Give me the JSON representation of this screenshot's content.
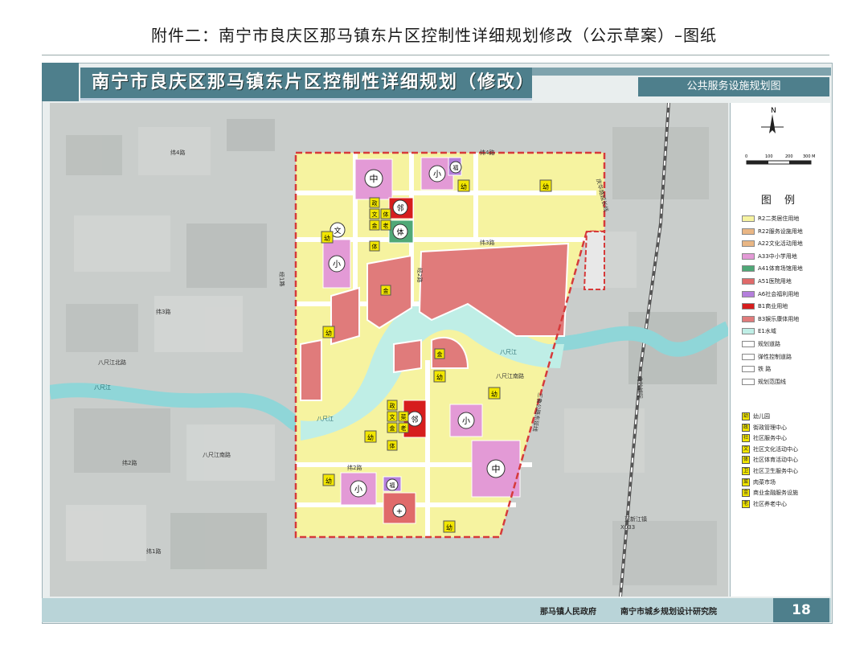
{
  "page_title": "附件二：南宁市良庆区那马镇东片区控制性详细规划修改（公示草案）–图纸",
  "map_title": "南宁市良庆区那马镇东片区控制性详细规划（修改）",
  "map_subtitle": "公共服务设施规划图",
  "north_label": "N",
  "scale_labels": [
    "0",
    "100",
    "200",
    "300 M"
  ],
  "legend_title": "图  例",
  "legend_landuse": [
    {
      "label": "R2二类居住用地",
      "color": "#f6f3a0"
    },
    {
      "label": "R22服务设施用地",
      "color": "#e9b684"
    },
    {
      "label": "A22文化活动用地",
      "color": "#e9b684"
    },
    {
      "label": "A33中小学用地",
      "color": "#e39ad6"
    },
    {
      "label": "A41体育场馆用地",
      "color": "#4fa877"
    },
    {
      "label": "A51医院用地",
      "color": "#e06a6a"
    },
    {
      "label": "A6社会福利用地",
      "color": "#b47fdc"
    },
    {
      "label": "B1商业用地",
      "color": "#d61d1d"
    },
    {
      "label": "B3娱乐康体用地",
      "color": "#e07b7b"
    },
    {
      "label": "E1水域",
      "color": "#bfeee6"
    },
    {
      "label": "规划道路",
      "color": "#ffffff"
    },
    {
      "label": "弹性控制道路",
      "color": "#ffffff"
    },
    {
      "label": "铁    路",
      "color": "#ffffff"
    },
    {
      "label": "规划范围线",
      "color": "#ffffff"
    }
  ],
  "legend_facilities": [
    {
      "glyph": "幼",
      "label": "幼儿园"
    },
    {
      "glyph": "政",
      "label": "街政管理中心"
    },
    {
      "glyph": "社",
      "label": "社区服务中心"
    },
    {
      "glyph": "文",
      "label": "社区文化活动中心"
    },
    {
      "glyph": "体",
      "label": "社区体育活动中心"
    },
    {
      "glyph": "卫",
      "label": "社区卫生服务中心"
    },
    {
      "glyph": "菜",
      "label": "肉菜市场"
    },
    {
      "glyph": "金",
      "label": "商业金融服务设施"
    },
    {
      "glyph": "老",
      "label": "社区养老中心"
    }
  ],
  "map_labels": {
    "road_w4": "纬4路",
    "road_w4b": "纬4路",
    "road_w3": "纬3路",
    "road_w3b": "纬3路",
    "road_w2": "纬2路",
    "road_w2b": "纬2路",
    "road_w1": "纬1路",
    "road_jing1": "经1路",
    "road_jing2": "经2路",
    "road_qinghua": "庆华路延长线",
    "road_bachijiang_s": "八尺江南路",
    "road_bachijiang_n": "八尺江北路",
    "road_bachijiang_s2": "八尺江南路",
    "river_1": "八尺江",
    "river_2": "八尺江",
    "river_3": "八尺江",
    "rail": "南钦城际",
    "hwy": "X033",
    "zhixin": "至新江镇",
    "sanshe": "三鲁公路东延线"
  },
  "markers": {
    "zhong": "中",
    "xiao": "小",
    "fu": "福",
    "you": "幼",
    "wen": "文",
    "jin": "金",
    "ti": "体",
    "zheng": "政",
    "lao": "老",
    "cai": "菜",
    "shang": "邻"
  },
  "footer": {
    "org1": "那马镇人民政府",
    "org2": "南宁市城乡规划设计研究院",
    "page": "18"
  }
}
